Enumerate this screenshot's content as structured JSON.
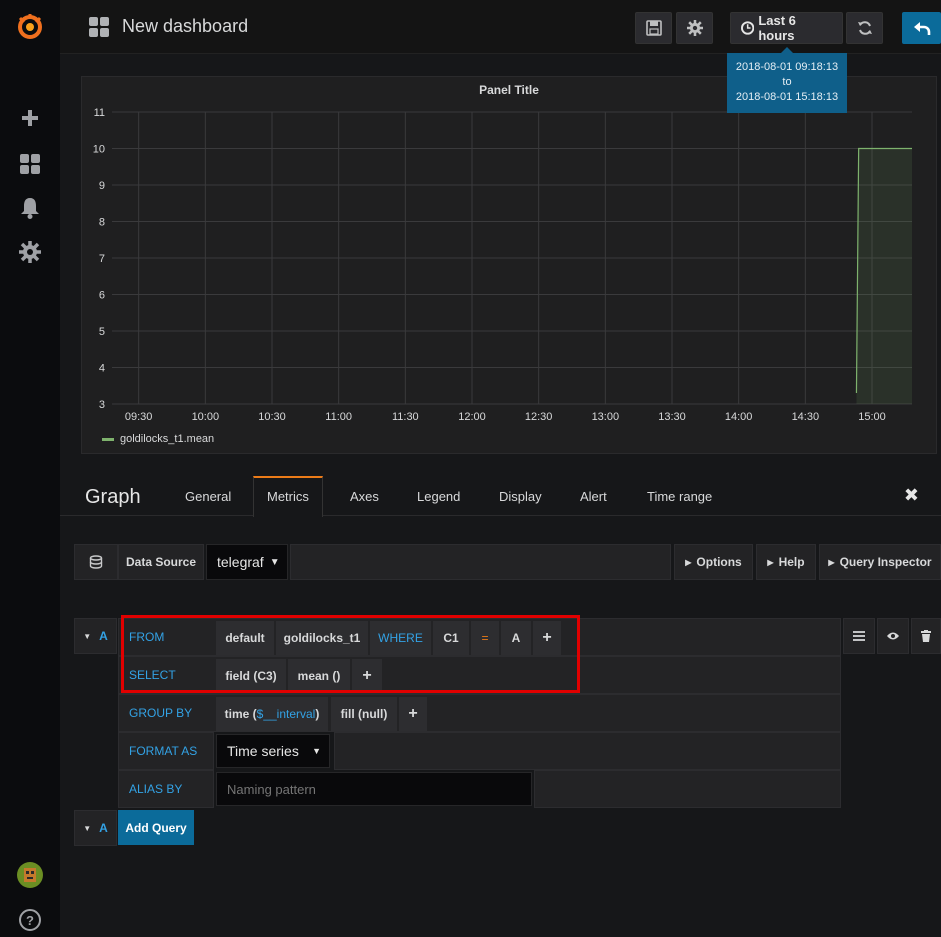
{
  "app": {
    "logo": "grafana-logo-icon"
  },
  "topbar": {
    "title": "New dashboard",
    "time_range_label": "Last 6 hours",
    "tooltip": {
      "from": "2018-08-01 09:18:13",
      "to_word": "to",
      "to": "2018-08-01 15:18:13"
    }
  },
  "sidebar": {
    "items": [
      {
        "icon": "plus-icon"
      },
      {
        "icon": "dashboards-icon"
      },
      {
        "icon": "bell-icon"
      },
      {
        "icon": "gear-icon"
      }
    ],
    "bottom": [
      {
        "icon": "avatar"
      },
      {
        "icon": "help-icon",
        "label": "?"
      }
    ]
  },
  "panel": {
    "title": "Panel Title",
    "legend": "goldilocks_t1.mean",
    "series_color": "#7eb26d"
  },
  "chart_data": {
    "type": "line",
    "title": "Panel Title",
    "x_ticks": [
      "09:30",
      "10:00",
      "10:30",
      "11:00",
      "11:30",
      "12:00",
      "12:30",
      "13:00",
      "13:30",
      "14:00",
      "14:30",
      "15:00"
    ],
    "y_ticks": [
      3,
      4,
      5,
      6,
      7,
      8,
      9,
      10,
      11
    ],
    "ylim": [
      3,
      11
    ],
    "series": [
      {
        "name": "goldilocks_t1.mean",
        "x": [
          "14:53",
          "14:54",
          "15:18"
        ],
        "values": [
          3.3,
          10,
          10
        ]
      }
    ],
    "grid": true,
    "legend_position": "bottom-left"
  },
  "editor": {
    "title": "Graph",
    "tabs": [
      "General",
      "Metrics",
      "Axes",
      "Legend",
      "Display",
      "Alert",
      "Time range"
    ],
    "active_tab": "Metrics",
    "close_label": "✖"
  },
  "datasource": {
    "label": "Data Source",
    "value": "telegraf",
    "options_label": "Options",
    "help_label": "Help",
    "inspector_label": "Query Inspector"
  },
  "query": {
    "ref": "A",
    "from_label": "FROM",
    "from_policy": "default",
    "from_measurement": "goldilocks_t1",
    "where_label": "WHERE",
    "where_key": "C1",
    "where_op": "=",
    "where_value": "A",
    "select_label": "SELECT",
    "select_field": "field (C3)",
    "select_fn": "mean ()",
    "group_label": "GROUP BY",
    "group_time_prefix": "time (",
    "group_time_var": "$__interval",
    "group_time_suffix": ")",
    "group_fill": "fill (null)",
    "format_label": "FORMAT AS",
    "format_value": "Time series",
    "alias_label": "ALIAS BY",
    "alias_placeholder": "Naming pattern",
    "plus": "+"
  },
  "add_query": {
    "ref": "A",
    "label": "Add Query"
  }
}
